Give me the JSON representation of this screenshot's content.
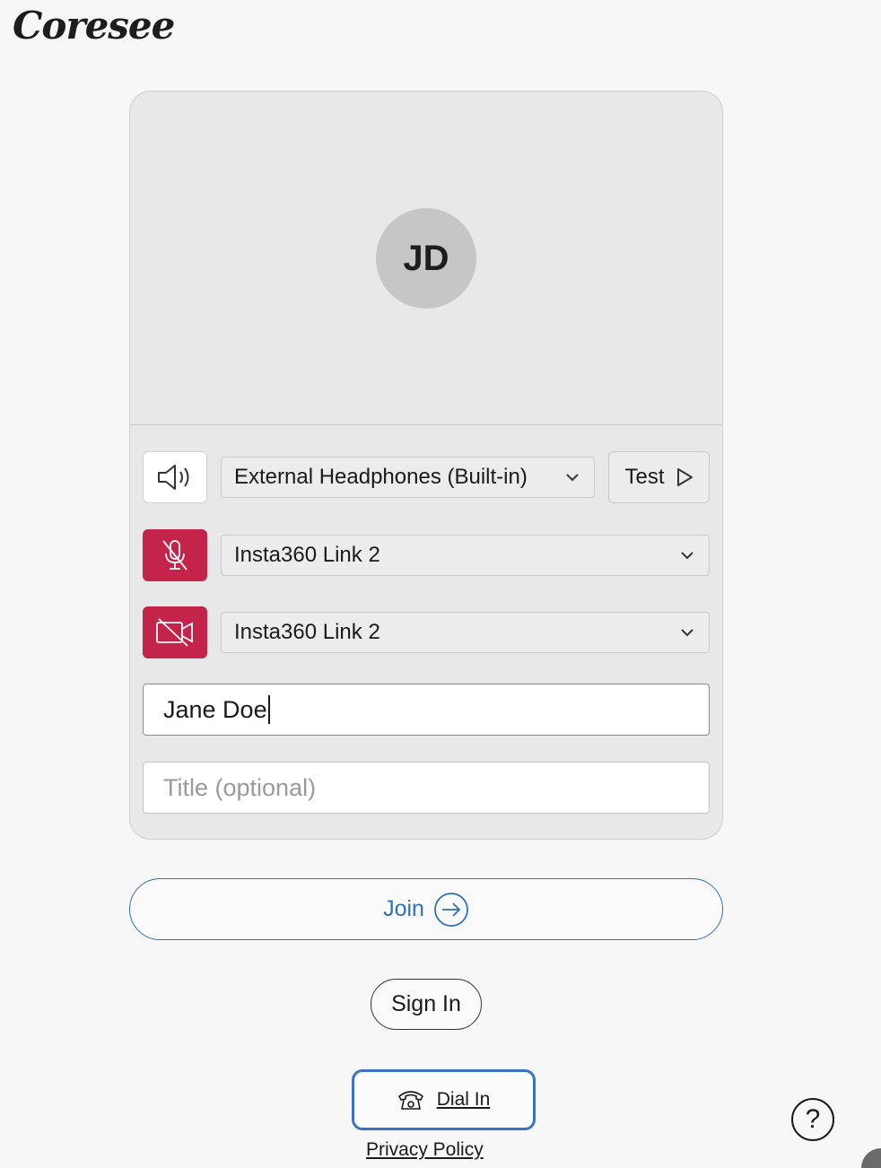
{
  "app": {
    "logo": "Coresee"
  },
  "preview": {
    "avatar_initials": "JD"
  },
  "devices": {
    "speaker": {
      "icon": "speaker-icon",
      "selected": "External Headphones (Built-in)"
    },
    "test_label": "Test",
    "microphone": {
      "icon": "mic-off-icon",
      "selected": "Insta360 Link 2",
      "muted": true
    },
    "camera": {
      "icon": "camera-off-icon",
      "selected": "Insta360 Link 2",
      "muted": true
    }
  },
  "form": {
    "name_value": "Jane Doe",
    "title_placeholder": "Title (optional)"
  },
  "actions": {
    "join_label": "Join",
    "signin_label": "Sign In",
    "dialin_label": "Dial In",
    "privacy_label": "Privacy Policy",
    "help_label": "?"
  },
  "colors": {
    "muted_red": "#c4234a",
    "join_blue": "#2e6fc0",
    "focus_blue": "#3a72c4"
  }
}
